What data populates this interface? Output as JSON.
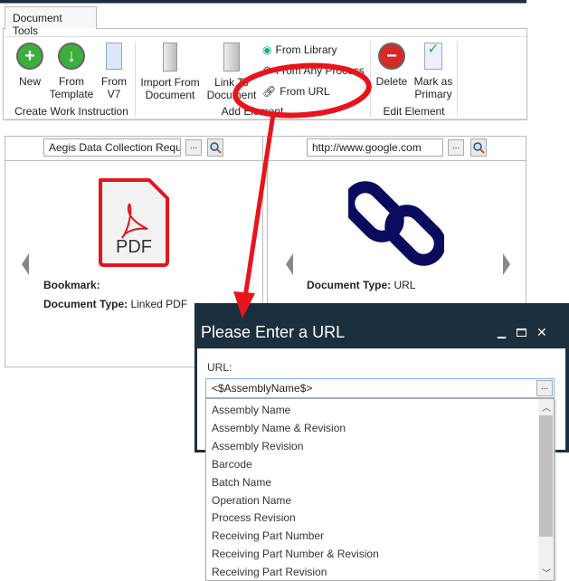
{
  "tab": {
    "label": "Document Tools"
  },
  "ribbon": {
    "groups": [
      {
        "label": "Create Work Instruction",
        "buttons": [
          {
            "label1": "New",
            "label2": ""
          },
          {
            "label1": "From",
            "label2": "Template"
          },
          {
            "label1": "From",
            "label2": "V7"
          }
        ]
      },
      {
        "label": "Add Element",
        "buttons": [
          {
            "label1": "Import From",
            "label2": "Document"
          },
          {
            "label1": "Link To",
            "label2": "Document"
          }
        ],
        "small": [
          "From Library",
          "From Any Process",
          "From URL"
        ]
      },
      {
        "label": "Edit Element",
        "buttons": [
          {
            "label1": "Delete",
            "label2": ""
          },
          {
            "label1": "Mark as",
            "label2": "Primary"
          }
        ]
      }
    ]
  },
  "left_panel": {
    "input": "Aegis Data Collection Requi",
    "dots": "...",
    "bookmark_label": "Bookmark:",
    "doctype_label": "Document Type:",
    "doctype_value": " Linked PDF",
    "icon_text": "PDF"
  },
  "right_panel": {
    "input": "http://www.google.com",
    "dots": "...",
    "doctype_label": "Document Type:",
    "doctype_value": " URL"
  },
  "dialog": {
    "title": "Please Enter a URL",
    "url_label": "URL:",
    "url_value": "<$AssemblyName$>",
    "dots": "...",
    "options": [
      "Assembly Name",
      "Assembly Name & Revision",
      "Assembly Revision",
      "Barcode",
      "Batch Name",
      "Operation Name",
      "Process Revision",
      "Receiving Part Number",
      "Receiving Part Number & Revision",
      "Receiving Part Revision"
    ]
  },
  "colors": {
    "annotation": "#e8141c",
    "dialog_bg": "#1b2f3f",
    "chain": "#0b0b5e",
    "pdf": "#e8141c"
  }
}
